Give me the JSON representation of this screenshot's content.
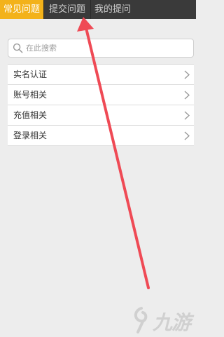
{
  "tabs": [
    {
      "label": "常见问题",
      "active": true
    },
    {
      "label": "提交问题",
      "active": false
    },
    {
      "label": "我的提问",
      "active": false
    }
  ],
  "search": {
    "placeholder": "在此搜索"
  },
  "menu": [
    {
      "label": "实名认证"
    },
    {
      "label": "账号相关"
    },
    {
      "label": "充值相关"
    },
    {
      "label": "登录相关"
    }
  ],
  "colors": {
    "tab_active": "#f3b21a",
    "tabbar": "#3a3a3a",
    "arrow": "#ef4a55"
  },
  "watermark": {
    "text": "九游",
    "icon": "nine-game-logo"
  }
}
